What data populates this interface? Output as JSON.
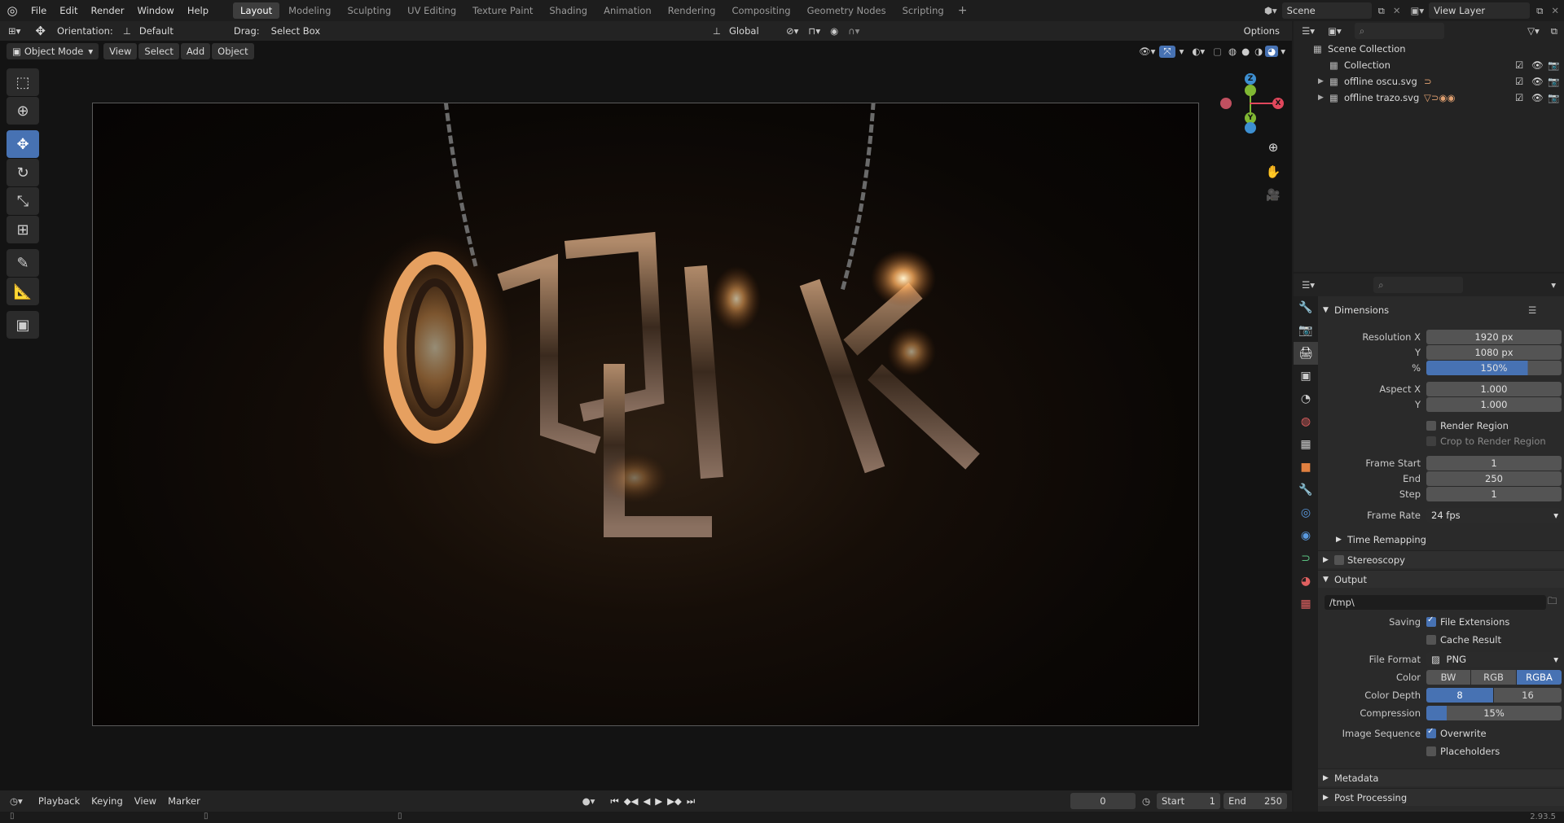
{
  "menu": {
    "items": [
      "File",
      "Edit",
      "Render",
      "Window",
      "Help"
    ]
  },
  "workspaces": [
    "Layout",
    "Modeling",
    "Sculpting",
    "UV Editing",
    "Texture Paint",
    "Shading",
    "Animation",
    "Rendering",
    "Compositing",
    "Geometry Nodes",
    "Scripting"
  ],
  "active_workspace": "Layout",
  "scene": {
    "name": "Scene",
    "view_layer": "View Layer"
  },
  "header": {
    "orientation_label": "Orientation:",
    "orientation_value": "Default",
    "drag_label": "Drag:",
    "drag_value": "Select Box",
    "transform_space": "Global",
    "options": "Options"
  },
  "viewport": {
    "mode": "Object Mode",
    "menus": [
      "View",
      "Select",
      "Add",
      "Object"
    ],
    "axes": {
      "x": "X",
      "y": "Y",
      "z": "Z"
    }
  },
  "outliner": {
    "root": "Scene Collection",
    "items": [
      "Collection",
      "offline oscu.svg",
      "offline trazo.svg"
    ]
  },
  "properties": {
    "dimensions": {
      "title": "Dimensions",
      "resolution_x_label": "Resolution X",
      "resolution_x": "1920 px",
      "resolution_y_label": "Y",
      "resolution_y": "1080 px",
      "percent_label": "%",
      "percent": "150%",
      "aspect_x_label": "Aspect X",
      "aspect_x": "1.000",
      "aspect_y_label": "Y",
      "aspect_y": "1.000",
      "render_region": "Render Region",
      "crop": "Crop to Render Region",
      "frame_start_label": "Frame Start",
      "frame_start": "1",
      "end_label": "End",
      "end": "250",
      "step_label": "Step",
      "step": "1",
      "frame_rate_label": "Frame Rate",
      "frame_rate": "24 fps",
      "time_remapping": "Time Remapping"
    },
    "stereoscopy": "Stereoscopy",
    "output": {
      "title": "Output",
      "path": "/tmp\\",
      "saving_label": "Saving",
      "file_extensions": "File Extensions",
      "cache_result": "Cache Result",
      "file_format_label": "File Format",
      "file_format": "PNG",
      "color_label": "Color",
      "color_options": [
        "BW",
        "RGB",
        "RGBA"
      ],
      "color_depth_label": "Color Depth",
      "depth_options": [
        "8",
        "16"
      ],
      "compression_label": "Compression",
      "compression": "15%",
      "image_sequence_label": "Image Sequence",
      "overwrite": "Overwrite",
      "placeholders": "Placeholders"
    },
    "metadata": "Metadata",
    "post_processing": "Post Processing"
  },
  "timeline": {
    "menus": [
      "Playback",
      "Keying",
      "View",
      "Marker"
    ],
    "current_frame": "0",
    "start_label": "Start",
    "start": "1",
    "end_label": "End",
    "end": "250"
  },
  "version": "2.93.5",
  "colors": {
    "accent": "#4772b3",
    "x_axis": "#e0475c",
    "y_axis": "#80b833",
    "z_axis": "#3d8fd1"
  }
}
